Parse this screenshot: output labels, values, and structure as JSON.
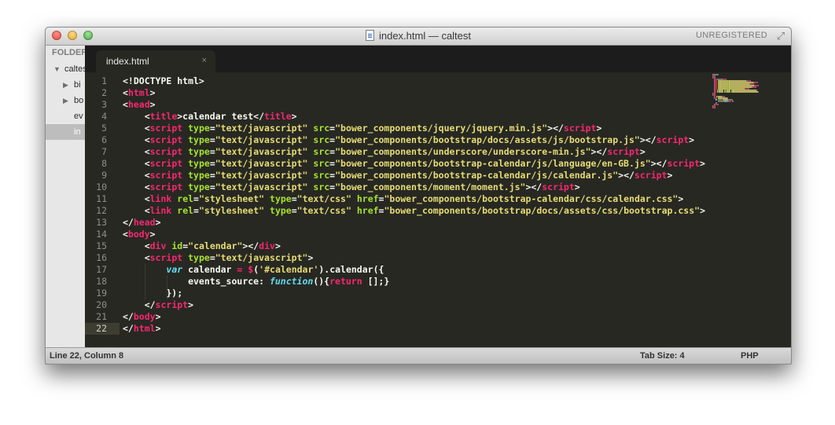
{
  "window": {
    "title": "index.html — caltest",
    "registration": "UNREGISTERED"
  },
  "sidebar": {
    "header": "FOLDERS",
    "items": [
      {
        "label": "caltest",
        "arrow": "▼"
      },
      {
        "label": "bi",
        "arrow": "▶"
      },
      {
        "label": "bo",
        "arrow": "▶"
      },
      {
        "label": "ev",
        "arrow": ""
      },
      {
        "label": "in",
        "arrow": ""
      }
    ]
  },
  "tabs": [
    {
      "label": "index.html",
      "close": "×"
    }
  ],
  "editor": {
    "active_line": 22,
    "lines": [
      [
        [
          "t",
          "<!DOCTYPE html>"
        ]
      ],
      [
        [
          "t",
          "<"
        ],
        [
          "tag",
          "html"
        ],
        [
          "t",
          ">"
        ]
      ],
      [
        [
          "t",
          "<"
        ],
        [
          "tag",
          "head"
        ],
        [
          "t",
          ">"
        ]
      ],
      [
        [
          "t",
          "    <"
        ],
        [
          "tag",
          "title"
        ],
        [
          "t",
          ">calendar test</"
        ],
        [
          "tag",
          "title"
        ],
        [
          "t",
          ">"
        ]
      ],
      [
        [
          "t",
          "    <"
        ],
        [
          "tag",
          "script"
        ],
        [
          "t",
          " "
        ],
        [
          "attr",
          "type"
        ],
        [
          "t",
          "="
        ],
        [
          "str",
          "\"text/javascript\""
        ],
        [
          "t",
          " "
        ],
        [
          "attr",
          "src"
        ],
        [
          "t",
          "="
        ],
        [
          "str",
          "\"bower_components/jquery/jquery.min.js\""
        ],
        [
          "t",
          "></"
        ],
        [
          "tag",
          "script"
        ],
        [
          "t",
          ">"
        ]
      ],
      [
        [
          "t",
          "    <"
        ],
        [
          "tag",
          "script"
        ],
        [
          "t",
          " "
        ],
        [
          "attr",
          "type"
        ],
        [
          "t",
          "="
        ],
        [
          "str",
          "\"text/javascript\""
        ],
        [
          "t",
          " "
        ],
        [
          "attr",
          "src"
        ],
        [
          "t",
          "="
        ],
        [
          "str",
          "\"bower_components/bootstrap/docs/assets/js/bootstrap.js\""
        ],
        [
          "t",
          "></"
        ],
        [
          "tag",
          "script"
        ],
        [
          "t",
          ">"
        ]
      ],
      [
        [
          "t",
          "    <"
        ],
        [
          "tag",
          "script"
        ],
        [
          "t",
          " "
        ],
        [
          "attr",
          "type"
        ],
        [
          "t",
          "="
        ],
        [
          "str",
          "\"text/javascript\""
        ],
        [
          "t",
          " "
        ],
        [
          "attr",
          "src"
        ],
        [
          "t",
          "="
        ],
        [
          "str",
          "\"bower_components/underscore/underscore-min.js\""
        ],
        [
          "t",
          "></"
        ],
        [
          "tag",
          "script"
        ],
        [
          "t",
          ">"
        ]
      ],
      [
        [
          "t",
          "    <"
        ],
        [
          "tag",
          "script"
        ],
        [
          "t",
          " "
        ],
        [
          "attr",
          "type"
        ],
        [
          "t",
          "="
        ],
        [
          "str",
          "\"text/javascript\""
        ],
        [
          "t",
          " "
        ],
        [
          "attr",
          "src"
        ],
        [
          "t",
          "="
        ],
        [
          "str",
          "\"bower_components/bootstrap-calendar/js/language/en-GB.js\""
        ],
        [
          "t",
          "></"
        ],
        [
          "tag",
          "script"
        ],
        [
          "t",
          ">"
        ]
      ],
      [
        [
          "t",
          "    <"
        ],
        [
          "tag",
          "script"
        ],
        [
          "t",
          " "
        ],
        [
          "attr",
          "type"
        ],
        [
          "t",
          "="
        ],
        [
          "str",
          "\"text/javascript\""
        ],
        [
          "t",
          " "
        ],
        [
          "attr",
          "src"
        ],
        [
          "t",
          "="
        ],
        [
          "str",
          "\"bower_components/bootstrap-calendar/js/calendar.js\""
        ],
        [
          "t",
          "></"
        ],
        [
          "tag",
          "script"
        ],
        [
          "t",
          ">"
        ]
      ],
      [
        [
          "t",
          "    <"
        ],
        [
          "tag",
          "script"
        ],
        [
          "t",
          " "
        ],
        [
          "attr",
          "type"
        ],
        [
          "t",
          "="
        ],
        [
          "str",
          "\"text/javascript\""
        ],
        [
          "t",
          " "
        ],
        [
          "attr",
          "src"
        ],
        [
          "t",
          "="
        ],
        [
          "str",
          "\"bower_components/moment/moment.js\""
        ],
        [
          "t",
          "></"
        ],
        [
          "tag",
          "script"
        ],
        [
          "t",
          ">"
        ]
      ],
      [
        [
          "t",
          "    <"
        ],
        [
          "tag",
          "link"
        ],
        [
          "t",
          " "
        ],
        [
          "attr",
          "rel"
        ],
        [
          "t",
          "="
        ],
        [
          "str",
          "\"stylesheet\""
        ],
        [
          "t",
          " "
        ],
        [
          "attr",
          "type"
        ],
        [
          "t",
          "="
        ],
        [
          "str",
          "\"text/css\""
        ],
        [
          "t",
          " "
        ],
        [
          "attr",
          "href"
        ],
        [
          "t",
          "="
        ],
        [
          "str",
          "\"bower_components/bootstrap-calendar/css/calendar.css\""
        ],
        [
          "t",
          ">"
        ]
      ],
      [
        [
          "t",
          "    <"
        ],
        [
          "tag",
          "link"
        ],
        [
          "t",
          " "
        ],
        [
          "attr",
          "rel"
        ],
        [
          "t",
          "="
        ],
        [
          "str",
          "\"stylesheet\""
        ],
        [
          "t",
          " "
        ],
        [
          "attr",
          "type"
        ],
        [
          "t",
          "="
        ],
        [
          "str",
          "\"text/css\""
        ],
        [
          "t",
          " "
        ],
        [
          "attr",
          "href"
        ],
        [
          "t",
          "="
        ],
        [
          "str",
          "\"bower_components/bootstrap/docs/assets/css/bootstrap.css\""
        ],
        [
          "t",
          ">"
        ]
      ],
      [
        [
          "t",
          "</"
        ],
        [
          "tag",
          "head"
        ],
        [
          "t",
          ">"
        ]
      ],
      [
        [
          "t",
          "<"
        ],
        [
          "tag",
          "body"
        ],
        [
          "t",
          ">"
        ]
      ],
      [
        [
          "t",
          "    <"
        ],
        [
          "tag",
          "div"
        ],
        [
          "t",
          " "
        ],
        [
          "attr",
          "id"
        ],
        [
          "t",
          "="
        ],
        [
          "str",
          "\"calendar\""
        ],
        [
          "t",
          "></"
        ],
        [
          "tag",
          "div"
        ],
        [
          "t",
          ">"
        ]
      ],
      [
        [
          "t",
          "    <"
        ],
        [
          "tag",
          "script"
        ],
        [
          "t",
          " "
        ],
        [
          "attr",
          "type"
        ],
        [
          "t",
          "="
        ],
        [
          "str",
          "\"text/javascript\""
        ],
        [
          "t",
          ">"
        ]
      ],
      [
        [
          "t",
          "        "
        ],
        [
          "kw",
          "var"
        ],
        [
          "t",
          " calendar "
        ],
        [
          "op",
          "="
        ],
        [
          "t",
          " "
        ],
        [
          "op",
          "$"
        ],
        [
          "t",
          "("
        ],
        [
          "str",
          "'#calendar'"
        ],
        [
          "t",
          ").calendar({"
        ]
      ],
      [
        [
          "t",
          "            events_source: "
        ],
        [
          "kw",
          "function"
        ],
        [
          "t",
          "(){"
        ],
        [
          "op",
          "return"
        ],
        [
          "t",
          " [];}"
        ]
      ],
      [
        [
          "t",
          "        });"
        ]
      ],
      [
        [
          "t",
          "    </"
        ],
        [
          "tag",
          "script"
        ],
        [
          "t",
          ">"
        ]
      ],
      [
        [
          "t",
          "</"
        ],
        [
          "tag",
          "body"
        ],
        [
          "t",
          ">"
        ]
      ],
      [
        [
          "t",
          "</"
        ],
        [
          "tag",
          "html"
        ],
        [
          "t",
          ">"
        ]
      ]
    ]
  },
  "status": {
    "position": "Line 22, Column 8",
    "tab_size": "Tab Size: 4",
    "syntax": "PHP"
  },
  "colors": {
    "background": "#272822",
    "tag": "#f92672",
    "attribute": "#a6e22e",
    "string": "#e6db74",
    "keyword": "#66d9ef",
    "text": "#f8f8f2"
  }
}
